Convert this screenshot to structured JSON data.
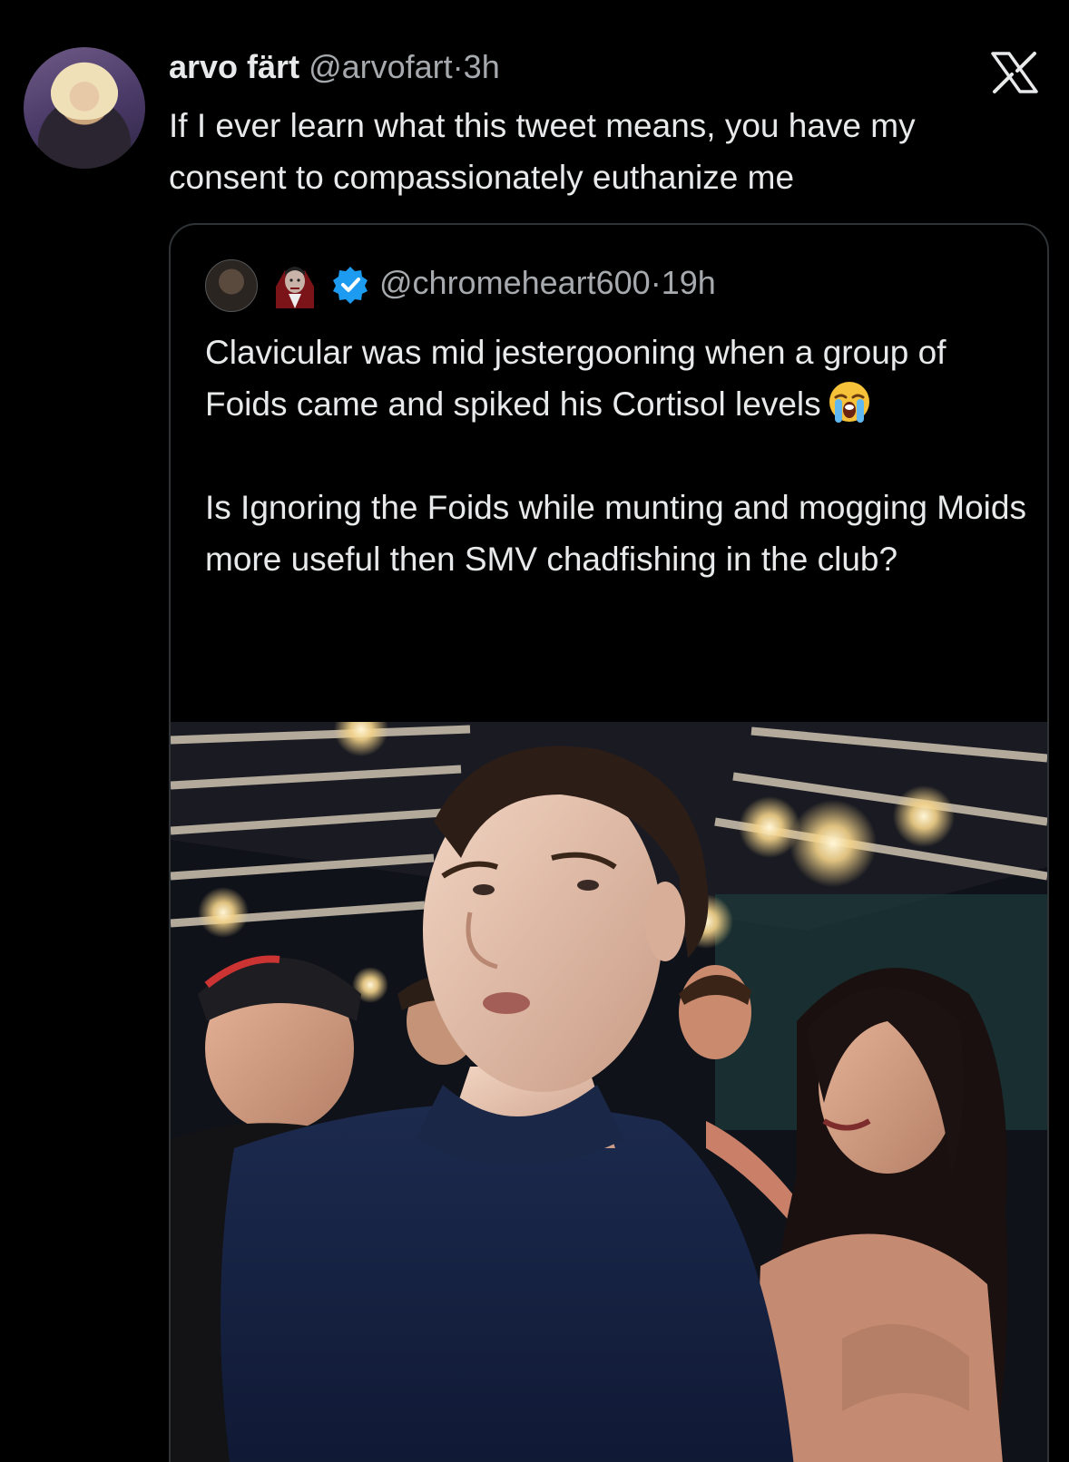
{
  "tweet": {
    "author_name": "arvo färt",
    "author_handle": "@arvofart",
    "separator": "·",
    "time": "3h",
    "text": "If I ever learn what this tweet means, you have my consent to compassionately euthanize me"
  },
  "quoted_tweet": {
    "handle": "@chromeheart600",
    "separator": "·",
    "time": "19h",
    "paragraph_1": "Clavicular was mid jestergooning when a group of Foids came and spiked his Cortisol levels",
    "paragraph_2": "Is Ignoring the Foids while munting and mogging Moids more useful then SMV chadfishing in the club?"
  },
  "icons": {
    "platform_logo": "x-logo-icon",
    "verified": "verified-badge-icon",
    "emoji_in_name": "vampire-emoji-icon",
    "emoji_in_text": "loudly-crying-face-icon"
  },
  "colors": {
    "background": "#000000",
    "text_primary": "#e7e9ea",
    "text_secondary": "#a6a9ad",
    "border": "#2f3336",
    "verified_blue": "#1d9bf0"
  }
}
